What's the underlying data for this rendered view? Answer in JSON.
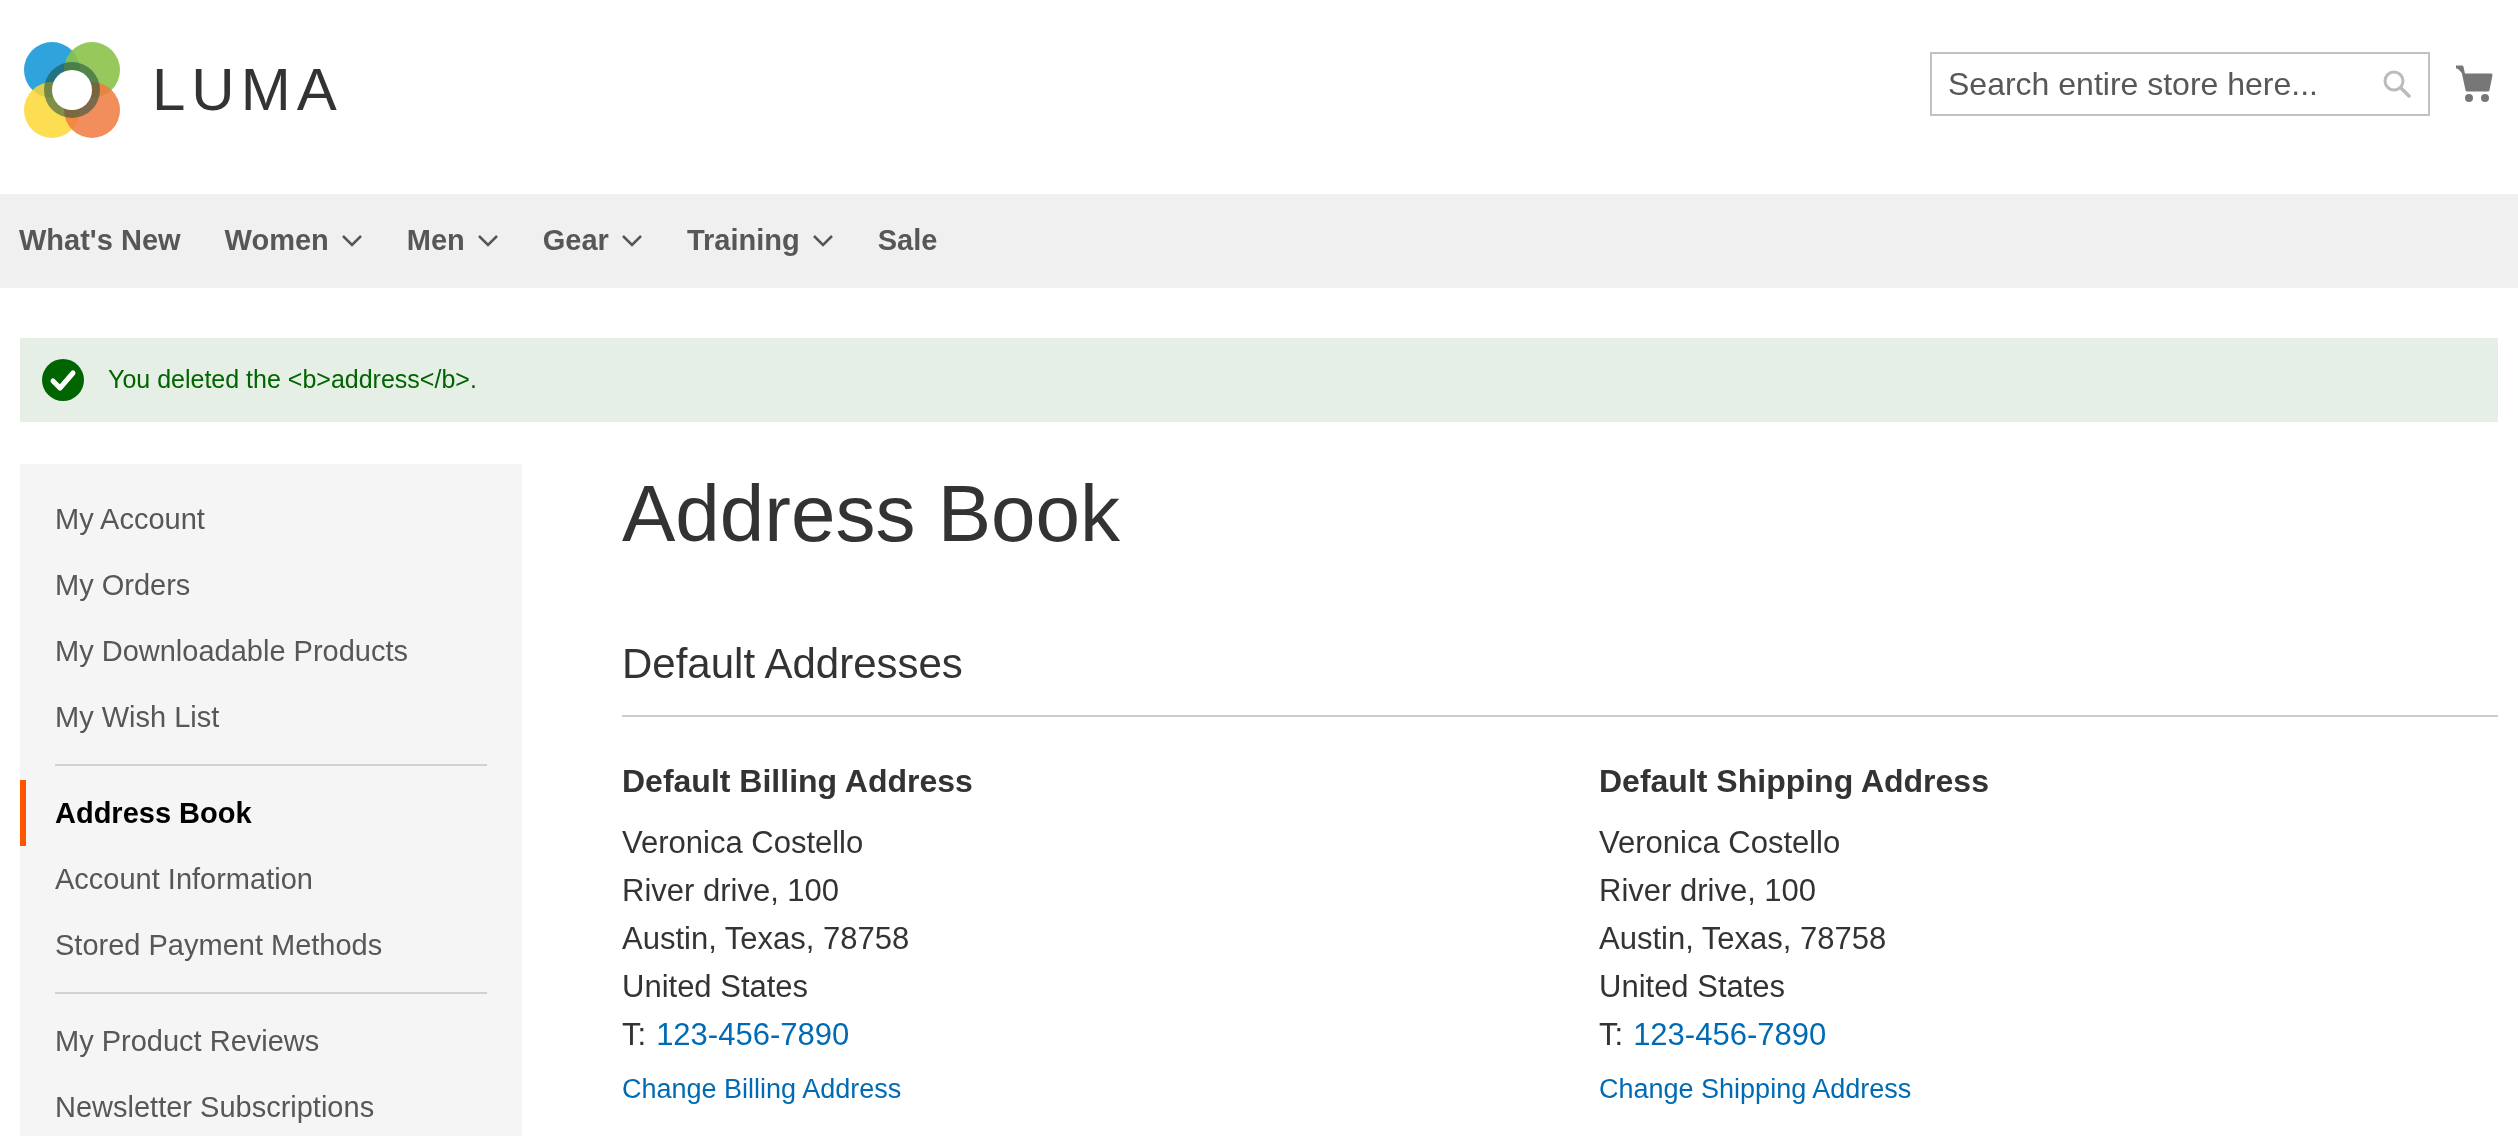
{
  "header": {
    "logo_text": "LUMA",
    "search": {
      "placeholder": "Search entire store here..."
    }
  },
  "nav": [
    {
      "label": "What's New",
      "has_menu": false
    },
    {
      "label": "Women",
      "has_menu": true
    },
    {
      "label": "Men",
      "has_menu": true
    },
    {
      "label": "Gear",
      "has_menu": true
    },
    {
      "label": "Training",
      "has_menu": true
    },
    {
      "label": "Sale",
      "has_menu": false
    }
  ],
  "message": {
    "text": "You deleted the <b>address</b>."
  },
  "sidebar": {
    "groups": [
      [
        {
          "label": "My Account",
          "selected": false
        },
        {
          "label": "My Orders",
          "selected": false
        },
        {
          "label": "My Downloadable Products",
          "selected": false
        },
        {
          "label": "My Wish List",
          "selected": false
        }
      ],
      [
        {
          "label": "Address Book",
          "selected": true
        },
        {
          "label": "Account Information",
          "selected": false
        },
        {
          "label": "Stored Payment Methods",
          "selected": false
        }
      ],
      [
        {
          "label": "My Product Reviews",
          "selected": false
        },
        {
          "label": "Newsletter Subscriptions",
          "selected": false
        }
      ]
    ]
  },
  "main": {
    "title": "Address Book",
    "section_title": "Default Addresses",
    "addresses": [
      {
        "title": "Default Billing Address",
        "lines": [
          "Veronica Costello",
          "River drive, 100",
          "Austin, Texas, 78758",
          "United States"
        ],
        "phone_label": "T:",
        "phone": "123-456-7890",
        "link": "Change Billing Address"
      },
      {
        "title": "Default Shipping Address",
        "lines": [
          "Veronica Costello",
          "River drive, 100",
          "Austin, Texas, 78758",
          "United States"
        ],
        "phone_label": "T:",
        "phone": "123-456-7890",
        "link": "Change Shipping Address"
      }
    ]
  }
}
